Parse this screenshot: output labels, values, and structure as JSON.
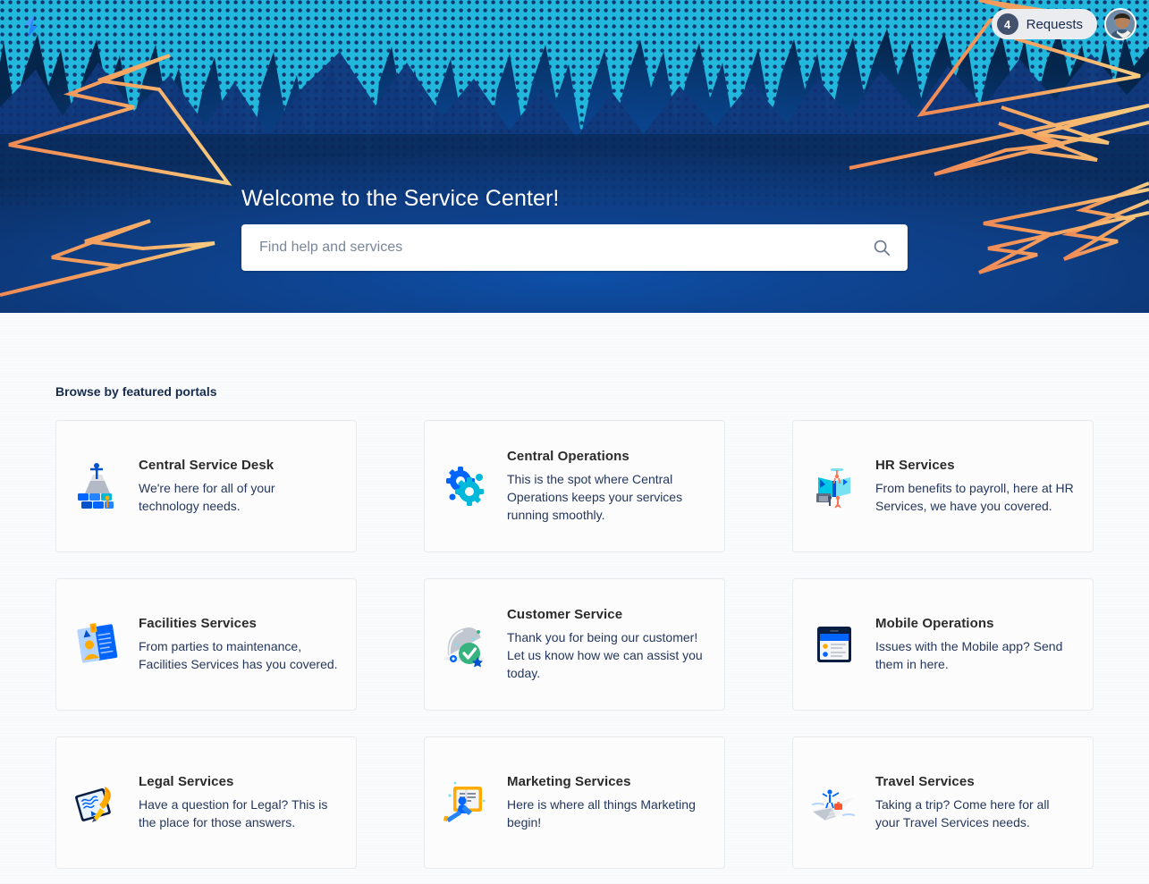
{
  "header": {
    "logo_icon": "lightning-bolt-logo",
    "requests_count": "4",
    "requests_label": "Requests",
    "avatar_alt": "user-avatar"
  },
  "hero": {
    "title": "Welcome to the Service Center!",
    "search_placeholder": "Find help and services",
    "search_value": "",
    "search_icon": "search-icon",
    "colors": {
      "bg_deep": "#05234e",
      "bg_mid": "#0a4ea6",
      "cyan": "#22b8dd",
      "bolt_orange": "#f5a05a",
      "bolt_yellow": "#f7c873"
    }
  },
  "main": {
    "section_title": "Browse by featured portals",
    "portals": [
      {
        "title": "Central Service Desk",
        "description": "We're here for all of your technology needs.",
        "icon": "service-desk-blocks-icon"
      },
      {
        "title": "Central Operations",
        "description": "This is the spot where Central Operations keeps your services running smoothly.",
        "icon": "gears-icon"
      },
      {
        "title": "HR Services",
        "description": "From benefits to payroll, here at HR Services, we have you covered.",
        "icon": "hr-people-panels-icon"
      },
      {
        "title": "Facilities Services",
        "description": "From parties to maintenance, Facilities Services has you covered.",
        "icon": "facilities-badge-icon"
      },
      {
        "title": "Customer Service",
        "description": "Thank you for being our customer! Let us know how we can assist you today.",
        "icon": "service-dome-check-icon"
      },
      {
        "title": "Mobile Operations",
        "description": "Issues with the Mobile app? Send them in here.",
        "icon": "mobile-device-icon"
      },
      {
        "title": "Legal Services",
        "description": "Have a question for Legal? This is the place for those answers.",
        "icon": "legal-tablet-pen-icon"
      },
      {
        "title": "Marketing Services",
        "description": "Here is where all things Marketing begin!",
        "icon": "marketing-board-icon"
      },
      {
        "title": "Travel Services",
        "description": "Taking a trip? Come here for all your Travel Services needs.",
        "icon": "travel-paper-plane-icon"
      }
    ]
  }
}
